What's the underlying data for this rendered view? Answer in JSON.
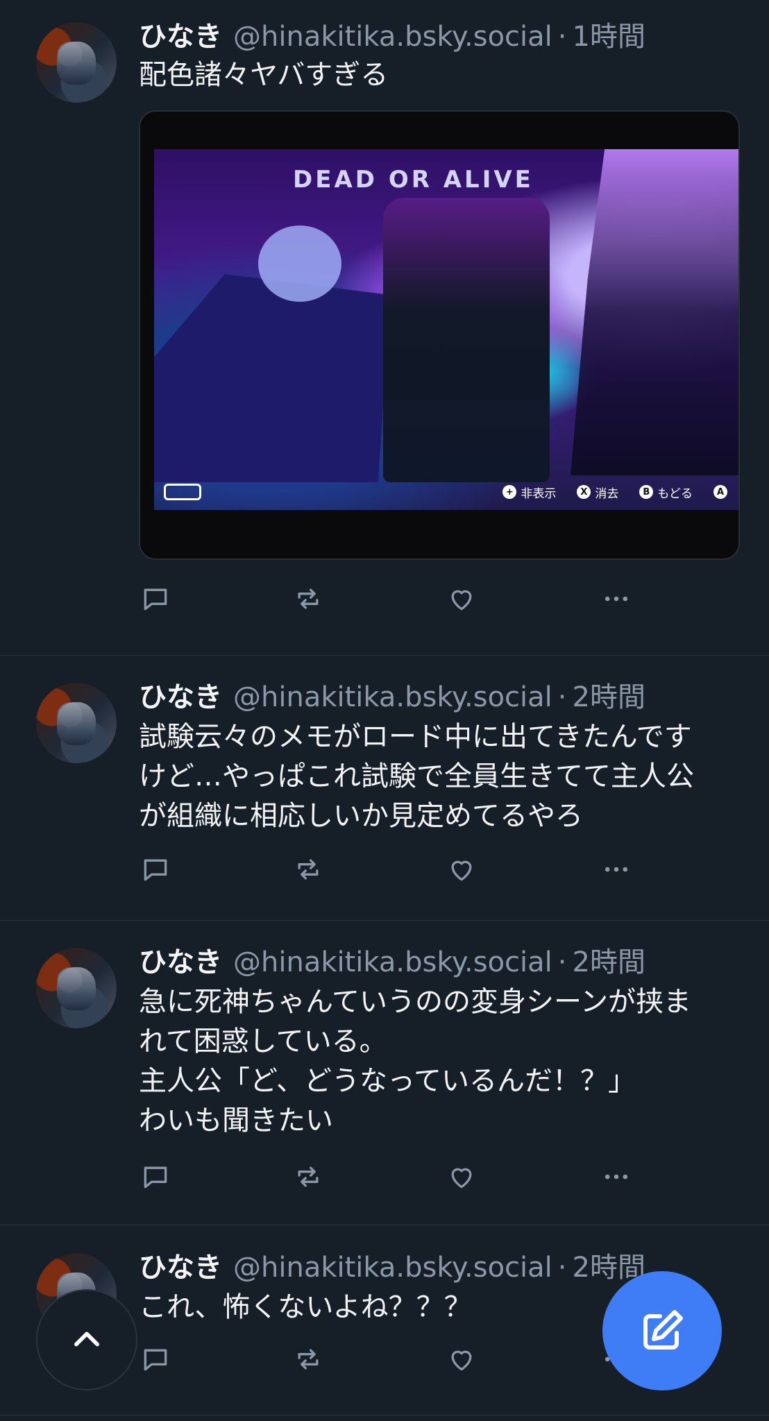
{
  "posts": [
    {
      "name": "ひなき",
      "handle": "@hinakitika.bsky.social",
      "time": "1時間",
      "text": "配色諸々ヤバすぎる",
      "media": {
        "title": "DEAD OR ALIVE",
        "hud": [
          {
            "button": "+",
            "label": "非表示"
          },
          {
            "button": "X",
            "label": "消去"
          },
          {
            "button": "B",
            "label": "もどる"
          },
          {
            "button": "A",
            "label": ""
          }
        ]
      }
    },
    {
      "name": "ひなき",
      "handle": "@hinakitika.bsky.social",
      "time": "2時間",
      "text": "試験云々のメモがロード中に出てきたんです\nけど…やっぱこれ試験で全員生きてて主人公\nが組織に相応しいか見定めてるやろ"
    },
    {
      "name": "ひなき",
      "handle": "@hinakitika.bsky.social",
      "time": "2時間",
      "text": "急に死神ちゃんていうのの変身シーンが挟ま\nれて困惑している。\n主人公「ど、どうなっているんだ！？」\nわいも聞きたい"
    },
    {
      "name": "ひなき",
      "handle": "@hinakitika.bsky.social",
      "time": "2時間",
      "text": "これ、怖くないよね？？？"
    }
  ],
  "separator": "·",
  "icons": {
    "reply": "reply-icon",
    "repost": "repost-icon",
    "like": "heart-icon",
    "more": "more-icon",
    "scroll_top": "chevron-up-icon",
    "compose": "compose-icon"
  },
  "colors": {
    "background": "#161e27",
    "muted": "#8a98a8",
    "accent": "#3f7df6"
  }
}
